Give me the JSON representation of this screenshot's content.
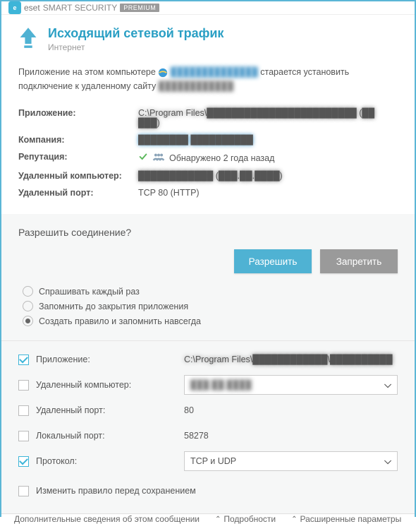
{
  "brand": {
    "eset": "eset",
    "product": "SMART SECURITY",
    "edition": "PREMIUM"
  },
  "header": {
    "title": "Исходящий сетевой трафик",
    "subtitle": "Интернет"
  },
  "desc": {
    "p1a": "Приложение на этом компьютере ",
    "app_blur": "██████████████",
    "p1b": " старается установить подключение к удаленному сайту ",
    "site_blur": "████████████"
  },
  "info": {
    "app_label": "Приложение:",
    "app_value_blur": "C:\\Program Files\\████████████████████████ (██ ███)",
    "company_label": "Компания:",
    "company_value_blur": "████████ ██████████",
    "reputation_label": "Репутация:",
    "reputation_text": "Обнаружено 2 года назад",
    "remote_label": "Удаленный компьютер:",
    "remote_value_blur": "████████████ (███.██.████)",
    "port_label": "Удаленный порт:",
    "port_value": "TCP 80 (HTTP)"
  },
  "question": "Разрешить соединение?",
  "buttons": {
    "allow": "Разрешить",
    "deny": "Запретить"
  },
  "radios": {
    "r1": "Спрашивать каждый раз",
    "r2": "Запомнить до закрытия приложения",
    "r3": "Создать правило и запомнить навсегда"
  },
  "rules": {
    "app_label": "Приложение:",
    "app_value_blur": "C:\\Program Files\\████████████\\██████████",
    "remote_label": "Удаленный компьютер:",
    "remote_value_blur": "███.██.████",
    "rport_label": "Удаленный порт:",
    "rport_value": "80",
    "lport_label": "Локальный порт:",
    "lport_value": "58278",
    "proto_label": "Протокол:",
    "proto_value": "TCP и UDP",
    "edit_label": "Изменить правило перед сохранением"
  },
  "footer": {
    "more": "Дополнительные сведения об этом сообщении",
    "details": "Подробности",
    "advanced": "Расширенные параметры"
  }
}
